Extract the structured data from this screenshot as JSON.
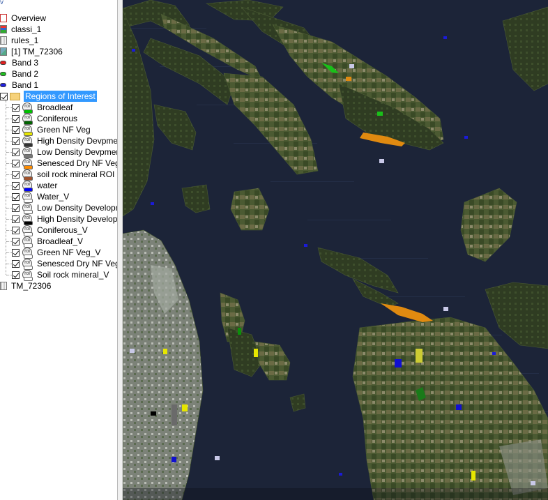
{
  "tree": {
    "items": [
      {
        "label": "Overview",
        "kind": "overview"
      },
      {
        "label": "classi_1",
        "kind": "classi"
      },
      {
        "label": "rules_1",
        "kind": "grid"
      },
      {
        "label": "[1] TM_72306",
        "kind": "tm"
      },
      {
        "label": "Band 3",
        "kind": "band",
        "color": "#e02020"
      },
      {
        "label": "Band 2",
        "kind": "band",
        "color": "#20c020"
      },
      {
        "label": "Band 1",
        "kind": "band",
        "color": "#2020e0"
      }
    ],
    "roi_folder": {
      "label": "Regions of Interest",
      "selected": true
    },
    "rois": [
      {
        "label": "Broadleaf",
        "color": "#00c000"
      },
      {
        "label": "Coniferous",
        "color": "#006400"
      },
      {
        "label": "Green NF Veg",
        "color": "#e6e600"
      },
      {
        "label": "High Density Devpment",
        "color": "#333333"
      },
      {
        "label": "Low Density Devpment",
        "color": "#777777"
      },
      {
        "label": "Senesced Dry NF Veg",
        "color": "#ff8c00"
      },
      {
        "label": "soil rock mineral ROI",
        "color": "#a0522d"
      },
      {
        "label": "water",
        "color": "#0000ff"
      },
      {
        "label": "Water_V",
        "color": "#ffffff"
      },
      {
        "label": "Low Density Developme",
        "color": "#ffffff"
      },
      {
        "label": "High Density Developme",
        "color": "#000000"
      },
      {
        "label": "Coniferous_V",
        "color": "#ffffff"
      },
      {
        "label": "Broadleaf_V",
        "color": "#ffffff"
      },
      {
        "label": "Green NF Veg_V",
        "color": "#ffffff"
      },
      {
        "label": "Senesced Dry NF Veg_V",
        "color": "#ffffff"
      },
      {
        "label": "Soil rock mineral_V",
        "color": "#ffffff"
      }
    ],
    "footer_item": {
      "label": "TM_72306",
      "kind": "grid"
    }
  },
  "roi_icon_text": "roi",
  "map_colors": {
    "water": "#1c2438",
    "land": "#3d4a2a",
    "forest": "#2f3d22",
    "urban": "#8a8f86",
    "senesced": "#e08a10",
    "green_nf": "#e6e600",
    "broadleaf": "#19c019",
    "water_roi": "#1010d0"
  }
}
